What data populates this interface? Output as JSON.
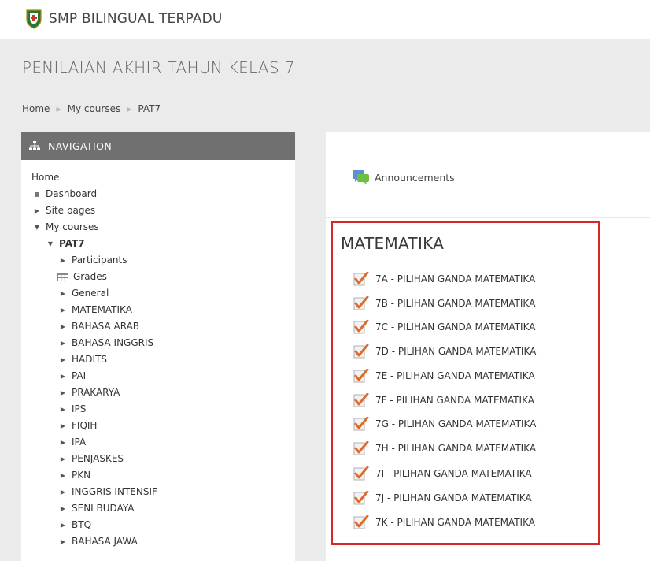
{
  "site": {
    "name": "SMP BILINGUAL TERPADU",
    "logo_icon": "school-crest-icon"
  },
  "page": {
    "title": "PENILAIAN AKHIR TAHUN KELAS 7"
  },
  "breadcrumb": [
    "Home",
    "My courses",
    "PAT7"
  ],
  "navigation": {
    "title": "NAVIGATION",
    "items": [
      {
        "label": "Home",
        "icon": "none"
      },
      {
        "label": "Dashboard",
        "icon": "bullet"
      },
      {
        "label": "Site pages",
        "icon": "triangle-right"
      },
      {
        "label": "My courses",
        "icon": "triangle-down"
      },
      {
        "label": "PAT7",
        "icon": "triangle-down"
      },
      {
        "label": "Participants",
        "icon": "triangle-right"
      },
      {
        "label": "Grades",
        "icon": "table-icon"
      },
      {
        "label": "General",
        "icon": "triangle-right"
      },
      {
        "label": "MATEMATIKA",
        "icon": "triangle-right"
      },
      {
        "label": "BAHASA ARAB",
        "icon": "triangle-right"
      },
      {
        "label": "BAHASA INGGRIS",
        "icon": "triangle-right"
      },
      {
        "label": "HADITS",
        "icon": "triangle-right"
      },
      {
        "label": "PAI",
        "icon": "triangle-right"
      },
      {
        "label": "PRAKARYA",
        "icon": "triangle-right"
      },
      {
        "label": "IPS",
        "icon": "triangle-right"
      },
      {
        "label": "FIQIH",
        "icon": "triangle-right"
      },
      {
        "label": "IPA",
        "icon": "triangle-right"
      },
      {
        "label": "PENJASKES",
        "icon": "triangle-right"
      },
      {
        "label": "PKN",
        "icon": "triangle-right"
      },
      {
        "label": "INGGRIS INTENSIF",
        "icon": "triangle-right"
      },
      {
        "label": "SENI BUDAYA",
        "icon": "triangle-right"
      },
      {
        "label": "BTQ",
        "icon": "triangle-right"
      },
      {
        "label": "BAHASA JAWA",
        "icon": "triangle-right"
      }
    ]
  },
  "announcements": {
    "label": "Announcements",
    "icon": "forum-icon"
  },
  "section": {
    "title": "MATEMATIKA",
    "activities": [
      "7A - PILIHAN GANDA MATEMATIKA",
      "7B - PILIHAN GANDA MATEMATIKA",
      "7C - PILIHAN GANDA MATEMATIKA",
      "7D - PILIHAN GANDA MATEMATIKA",
      "7E - PILIHAN GANDA MATEMATIKA",
      "7F - PILIHAN GANDA MATEMATIKA",
      "7G - PILIHAN GANDA MATEMATIKA",
      "7H - PILIHAN GANDA MATEMATIKA",
      "7I - PILIHAN GANDA MATEMATIKA",
      "7J - PILIHAN GANDA MATEMATIKA",
      "7K - PILIHAN GANDA MATEMATIKA"
    ],
    "activity_icon": "quiz-checkmark-icon"
  },
  "colors": {
    "highlight_border": "#d9262b",
    "nav_header": "#707070",
    "quiz_check": "#e06a2c"
  }
}
